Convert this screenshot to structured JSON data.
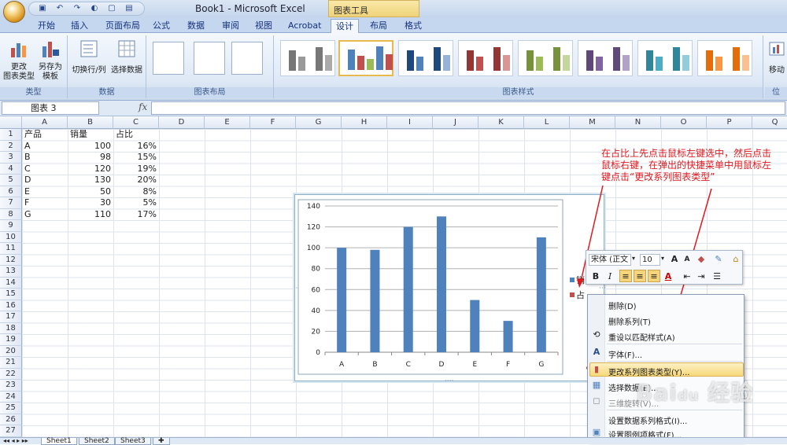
{
  "window": {
    "title": "Book1 - Microsoft Excel",
    "chart_tools_label": "图表工具"
  },
  "ribbon_tabs": [
    "开始",
    "插入",
    "页面布局",
    "公式",
    "数据",
    "审阅",
    "视图",
    "Acrobat",
    "设计",
    "布局",
    "格式"
  ],
  "ribbon": {
    "type_group": {
      "label": "类型",
      "change_type": "更改\n图表类型",
      "save_template": "另存为\n模板"
    },
    "data_group": {
      "label": "数据",
      "switch_row_col": "切换行/列",
      "select_data": "选择数据"
    },
    "layout_group": {
      "label": "图表布局"
    },
    "styles_group": {
      "label": "图表样式"
    },
    "location_group": {
      "label": "位",
      "move": "移动"
    }
  },
  "formula_bar": {
    "name_box": "图表 3",
    "fx": "fx",
    "formula": ""
  },
  "columns": [
    "A",
    "B",
    "C",
    "D",
    "E",
    "F",
    "G",
    "H",
    "I",
    "J",
    "K",
    "L",
    "M",
    "N",
    "O",
    "P",
    "Q"
  ],
  "rows": [
    "1",
    "2",
    "3",
    "4",
    "5",
    "6",
    "7",
    "8",
    "9",
    "10",
    "11",
    "12",
    "13",
    "14",
    "15",
    "16",
    "17",
    "18",
    "19",
    "20",
    "21",
    "22",
    "23",
    "24",
    "25",
    "26",
    "27"
  ],
  "table": {
    "header": [
      "产品",
      "销量",
      "占比"
    ],
    "rows": [
      [
        "A",
        "100",
        "16%"
      ],
      [
        "B",
        "98",
        "15%"
      ],
      [
        "C",
        "120",
        "19%"
      ],
      [
        "D",
        "130",
        "20%"
      ],
      [
        "E",
        "50",
        "8%"
      ],
      [
        "F",
        "30",
        "5%"
      ],
      [
        "G",
        "110",
        "17%"
      ]
    ]
  },
  "chart_data": {
    "type": "bar",
    "categories": [
      "A",
      "B",
      "C",
      "D",
      "E",
      "F",
      "G"
    ],
    "series": [
      {
        "name": "销量",
        "values": [
          100,
          98,
          120,
          130,
          50,
          30,
          110
        ],
        "color": "#4f81bd"
      },
      {
        "name": "占比",
        "values": [
          0.16,
          0.15,
          0.19,
          0.2,
          0.08,
          0.05,
          0.17
        ],
        "color": "#c0504d"
      }
    ],
    "yticks": [
      "0",
      "20",
      "40",
      "60",
      "80",
      "100",
      "120",
      "140"
    ],
    "ylim": [
      0,
      140
    ],
    "grid": true,
    "legend": "right"
  },
  "legend_visible": {
    "series1": "销",
    "series2": "占"
  },
  "annotation": "在占比上先点击鼠标左键选中，然后点击鼠标右键，在弹出的快捷菜单中用鼠标左键点击“更改系列图表类型”",
  "mini_toolbar": {
    "font": "宋体 (正文",
    "size": "10",
    "bold": "B",
    "italic": "I",
    "font_color_label": "A"
  },
  "context_menu": {
    "items": [
      "删除(D)",
      "删除系列(T)",
      "重设以匹配样式(A)",
      "字体(F)...",
      "更改系列图表类型(Y)...",
      "选择数据(E)...",
      "三维旋转(V)...",
      "设置数据系列格式(I)...",
      "设置图例项格式(F)..."
    ]
  },
  "sheet_tabs": [
    "Sheet1",
    "Sheet2",
    "Sheet3"
  ],
  "colors": {
    "accent_red": "#e0191e",
    "bar_blue": "#4f81bd",
    "ribbon_blue": "#c5d7ee"
  },
  "watermark": "Baidu经验"
}
